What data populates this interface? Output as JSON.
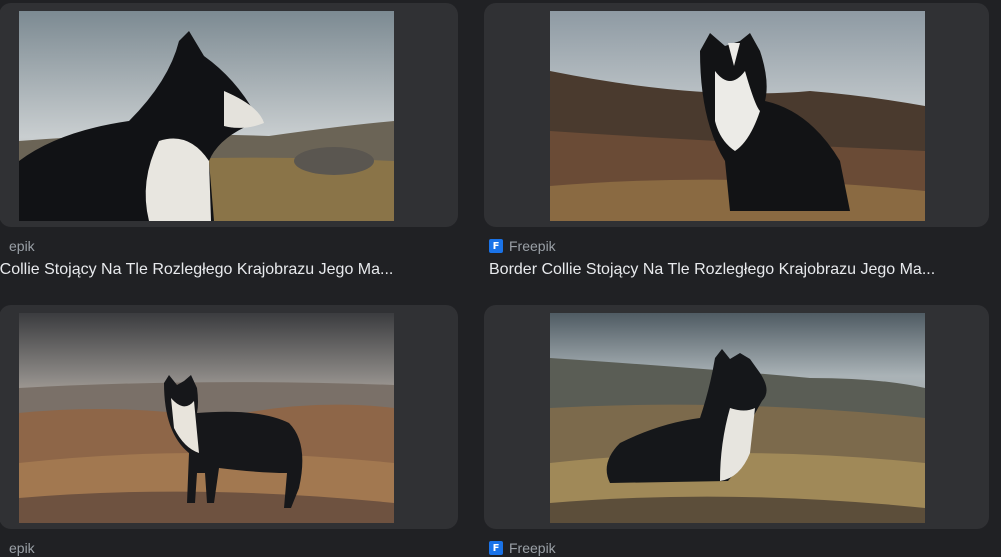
{
  "results": [
    {
      "source": "Freepik",
      "source_visible": "epik",
      "title": "Border Collie Stojący Na Tle Rozległego Krajobrazu Jego Ma...",
      "title_visible": "er Collie Stojący Na Tle Rozległego Krajobrazu Jego Ma..."
    },
    {
      "source": "Freepik",
      "source_visible": "Freepik",
      "title": "Border Collie Stojący Na Tle Rozległego Krajobrazu Jego Ma...",
      "title_visible": "Border Collie Stojący Na Tle Rozległego Krajobrazu Jego Ma..."
    },
    {
      "source": "Freepik",
      "source_visible": "epik"
    },
    {
      "source": "Freepik",
      "source_visible": "Freepik"
    }
  ],
  "favicon_glyph": "F",
  "colors": {
    "background": "#202124",
    "card": "#303134",
    "title": "#e8eaed",
    "source": "#9aa0a6",
    "favicon": "#1a73e8"
  }
}
